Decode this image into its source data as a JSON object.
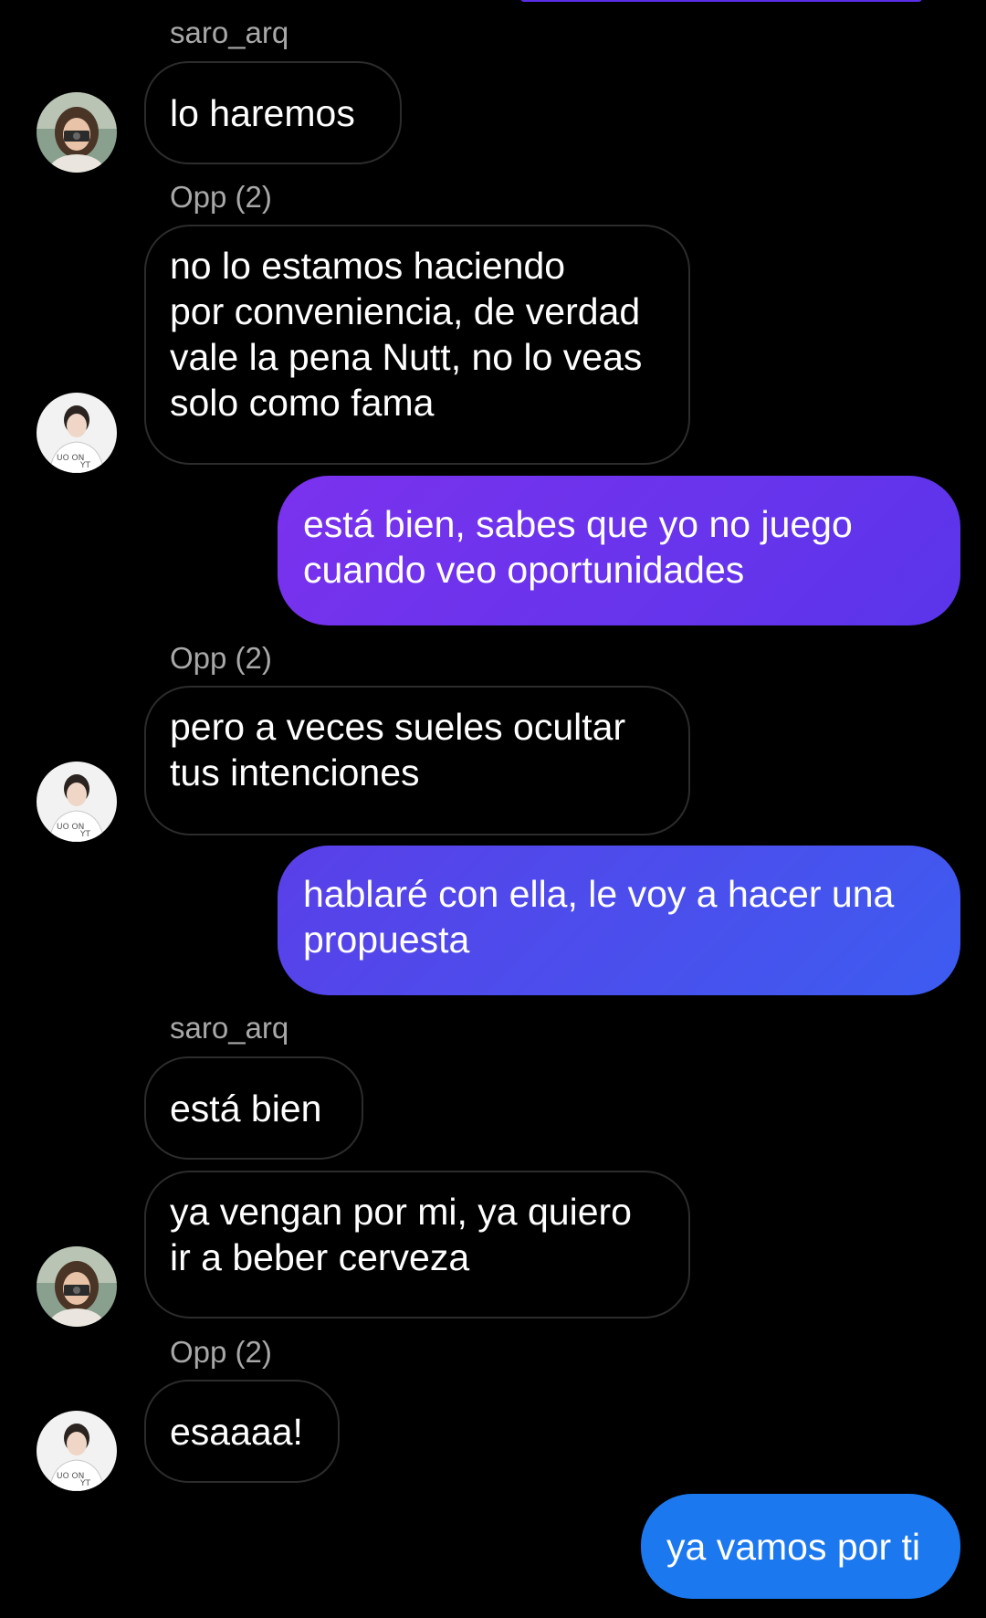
{
  "colors": {
    "background": "#000000",
    "incoming_border": "#2c2c2c",
    "sender_name": "#a8a8a8",
    "outgoing_1_start": "#7b32ee",
    "outgoing_1_end": "#5a35ea",
    "outgoing_2_start": "#5a3fe8",
    "outgoing_2_end": "#3d5cf0",
    "outgoing_3": "#1b78ef"
  },
  "messages": [
    {
      "type": "sender",
      "text": "saro_arq"
    },
    {
      "type": "incoming",
      "avatar": "avatar-saro-icon",
      "lines": [
        "lo haremos"
      ]
    },
    {
      "type": "sender",
      "text": "Opp (2)"
    },
    {
      "type": "incoming",
      "avatar": "avatar-opp-icon",
      "lines": [
        "no lo estamos haciendo",
        "por conveniencia, de verdad",
        "vale la pena Nutt, no lo veas",
        "solo como fama"
      ]
    },
    {
      "type": "outgoing",
      "lines": [
        "está bien, sabes que yo no juego",
        "cuando veo oportunidades"
      ]
    },
    {
      "type": "sender",
      "text": "Opp (2)"
    },
    {
      "type": "incoming",
      "avatar": "avatar-opp-icon",
      "lines": [
        "pero a veces sueles ocultar",
        "tus intenciones"
      ]
    },
    {
      "type": "outgoing",
      "lines": [
        "hablaré con ella, le voy a hacer una",
        "propuesta"
      ]
    },
    {
      "type": "sender",
      "text": "saro_arq"
    },
    {
      "type": "incoming",
      "lines": [
        "está bien"
      ]
    },
    {
      "type": "incoming",
      "avatar": "avatar-saro-icon",
      "lines": [
        "ya vengan por mi, ya quiero",
        "ir a beber cerveza"
      ]
    },
    {
      "type": "sender",
      "text": "Opp (2)"
    },
    {
      "type": "incoming",
      "avatar": "avatar-opp-icon",
      "lines": [
        "esaaaa!"
      ]
    },
    {
      "type": "outgoing",
      "lines": [
        "ya vamos por ti"
      ]
    }
  ]
}
